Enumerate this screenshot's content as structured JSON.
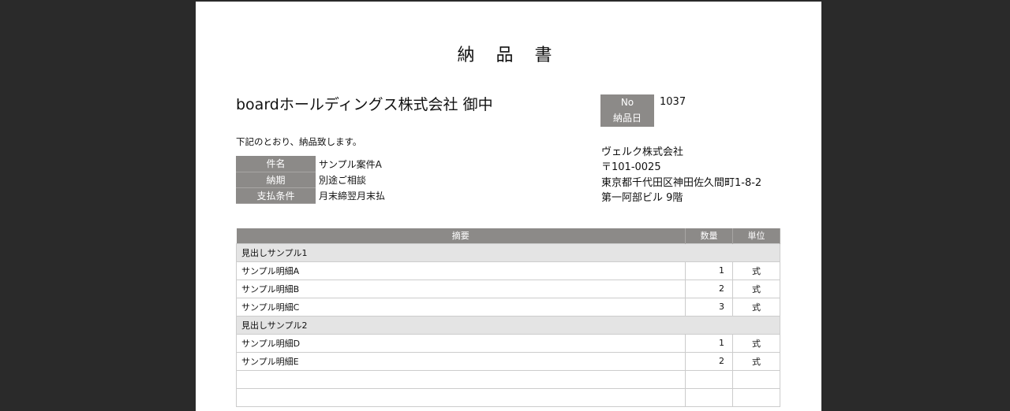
{
  "title": "納 品 書",
  "client": "boardホールディングス株式会社 御中",
  "lead": "下記のとおり、納品致します。",
  "info": [
    {
      "label": "件名",
      "value": "サンプル案件A"
    },
    {
      "label": "納期",
      "value": "別途ご相談"
    },
    {
      "label": "支払条件",
      "value": "月末締翌月末払"
    }
  ],
  "doc": {
    "no_label": "No",
    "no_value": "1037",
    "date_label": "納品日"
  },
  "issuer": {
    "name": "ヴェルク株式会社",
    "zip": "〒101-0025",
    "address": "東京都千代田区神田佐久間町1-8-2",
    "building": "第一阿部ビル 9階"
  },
  "table": {
    "headers": [
      "摘要",
      "数量",
      "単位"
    ],
    "rows": [
      {
        "type": "heading",
        "desc": "見出しサンプル1"
      },
      {
        "desc": "サンプル明細A",
        "qty": "1",
        "unit": "式"
      },
      {
        "desc": "サンプル明細B",
        "qty": "2",
        "unit": "式"
      },
      {
        "desc": "サンプル明細C",
        "qty": "3",
        "unit": "式"
      },
      {
        "type": "heading",
        "desc": "見出しサンプル2"
      },
      {
        "desc": "サンプル明細D",
        "qty": "1",
        "unit": "式"
      },
      {
        "desc": "サンプル明細E",
        "qty": "2",
        "unit": "式"
      },
      {
        "desc": "",
        "qty": "",
        "unit": ""
      },
      {
        "desc": "",
        "qty": "",
        "unit": ""
      }
    ]
  }
}
